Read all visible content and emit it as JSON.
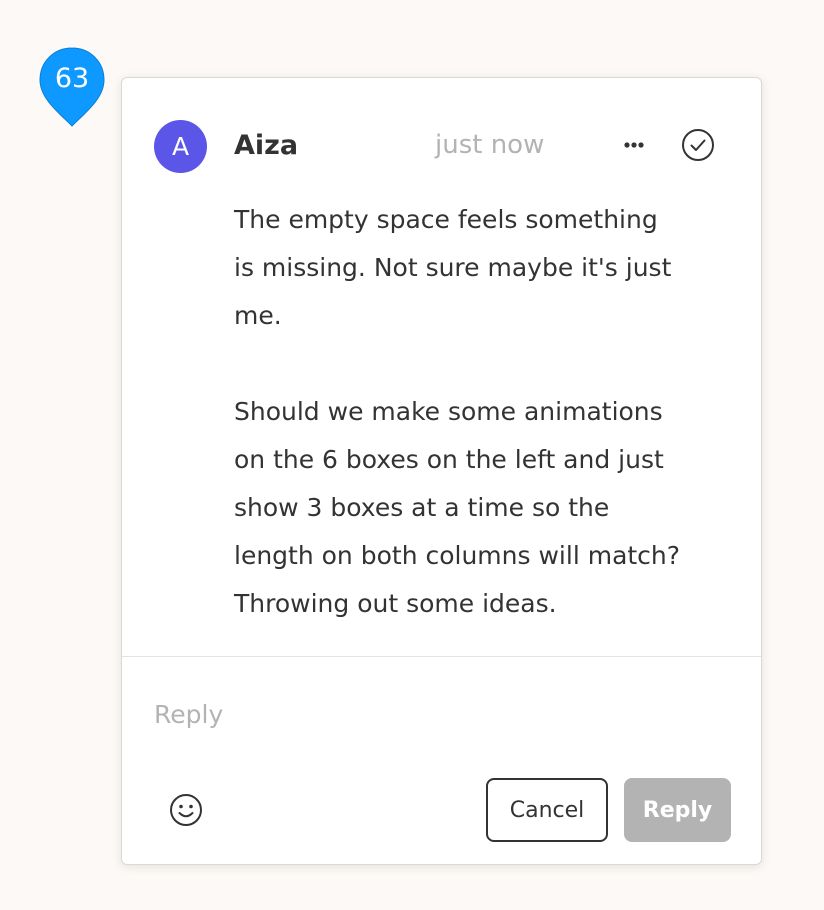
{
  "pin": {
    "count": "63",
    "color": "#0d99ff"
  },
  "comment": {
    "avatar_initial": "A",
    "avatar_color": "#5b55e8",
    "author": "Aiza",
    "timestamp": "just now",
    "more_icon": "more-horizontal-icon",
    "resolve_icon": "check-circle-icon",
    "paragraphs": [
      "The empty space feels something is missing. Not sure maybe it's just me.",
      "Should we make some animations on the 6 boxes on the left and just show 3 boxes at a time so the length on both columns will match? Throwing out some ideas."
    ]
  },
  "reply": {
    "placeholder": "Reply",
    "emoji_icon": "smiley-icon",
    "cancel_label": "Cancel",
    "submit_label": "Reply"
  }
}
